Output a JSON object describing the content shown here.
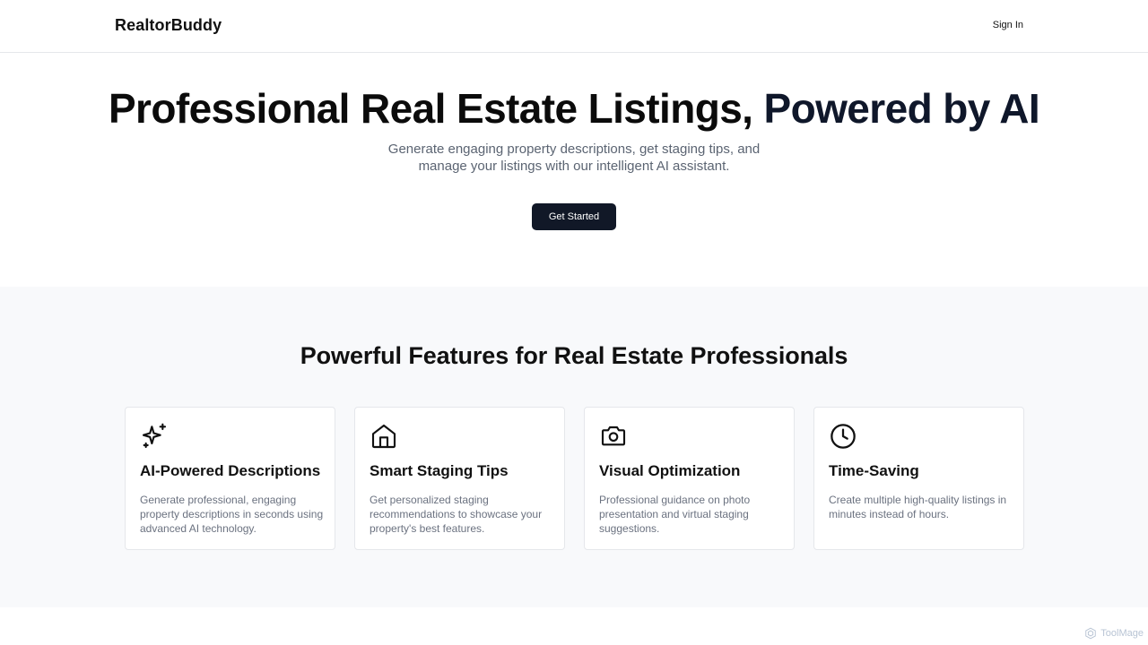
{
  "header": {
    "brand": "RealtorBuddy",
    "sign_in": "Sign In"
  },
  "hero": {
    "title_part1": "Professional Real Estate Listings,",
    "title_part2": "Powered by AI",
    "subtitle_line1": "Generate engaging property descriptions, get staging tips, and",
    "subtitle_line2": "manage your listings with our intelligent AI assistant.",
    "cta_label": "Get Started"
  },
  "features": {
    "title": "Powerful Features for Real Estate Professionals",
    "cards": [
      {
        "icon": "sparkles-icon",
        "title": "AI-Powered Descriptions",
        "description": "Generate professional, engaging property descriptions in seconds using advanced AI technology."
      },
      {
        "icon": "home-icon",
        "title": "Smart Staging Tips",
        "description": "Get personalized staging recommendations to showcase your property's best features."
      },
      {
        "icon": "camera-icon",
        "title": "Visual Optimization",
        "description": "Professional guidance on photo presentation and virtual staging suggestions."
      },
      {
        "icon": "clock-icon",
        "title": "Time-Saving",
        "description": "Create multiple high-quality listings in minutes instead of hours."
      }
    ]
  },
  "watermark": {
    "label": "ToolMage"
  },
  "colors": {
    "primary_button": "#111827",
    "section_background": "#f8f9fb",
    "muted_text": "#6b7280"
  }
}
